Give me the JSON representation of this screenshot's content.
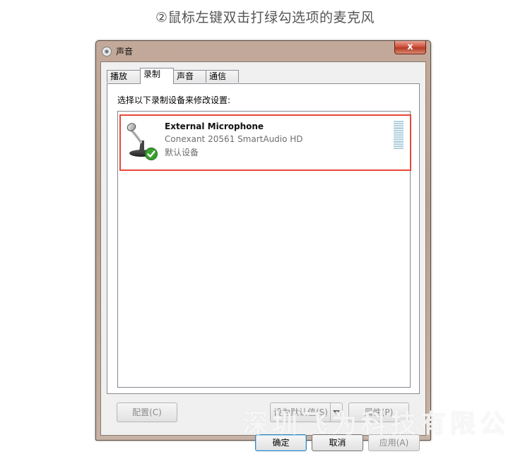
{
  "caption": "②鼠标左键双击打绿勾选项的麦克风",
  "window": {
    "title": "声音",
    "close_glyph": "x",
    "title_icon": "speaker-icon"
  },
  "tabs": [
    {
      "label": "播放",
      "active": false
    },
    {
      "label": "录制",
      "active": true
    },
    {
      "label": "声音",
      "active": false
    },
    {
      "label": "通信",
      "active": false
    }
  ],
  "panel": {
    "instruction": "选择以下录制设备来修改设置:"
  },
  "devices": [
    {
      "name": "External Microphone",
      "driver": "Conexant 20561 SmartAudio HD",
      "status": "默认设备",
      "icon": "microphone-icon",
      "badge_icon": "green-check-icon",
      "selected": true,
      "level_segments": 13
    }
  ],
  "buttons": {
    "configure": "配置(C)",
    "set_default": "设为默认值(S)",
    "properties": "属性(P)",
    "ok": "确定",
    "cancel": "取消",
    "apply": "应用(A)"
  },
  "watermark": "深圳飞为科技有限公司",
  "colors": {
    "selection_border": "#e8483a",
    "close_button": "#c94a36",
    "check_badge": "#3aa12f"
  }
}
